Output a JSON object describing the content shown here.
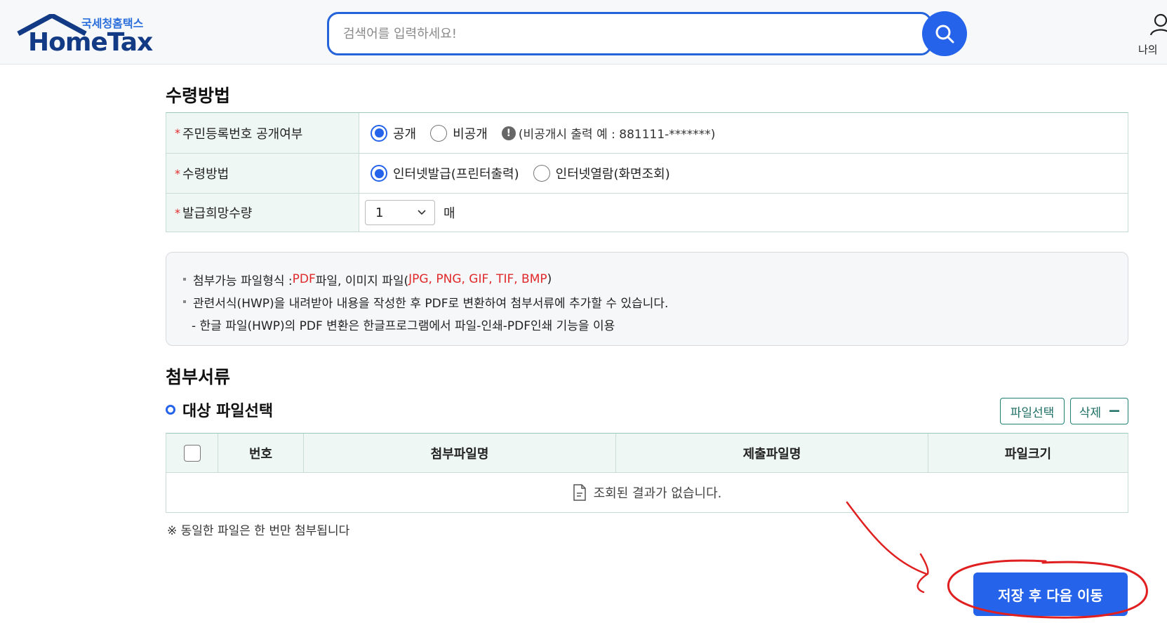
{
  "header": {
    "logo_sub": "국세청홈택스",
    "logo_name": "HomeTax",
    "search_placeholder": "검색어를 입력하세요!",
    "my_menu_label": "나의"
  },
  "receive_section": {
    "title": "수령방법",
    "rows": [
      {
        "label": "주민등록번호 공개여부",
        "options": [
          {
            "label": "공개",
            "selected": true
          },
          {
            "label": "비공개",
            "selected": false
          }
        ],
        "hint": "(비공개시 출력 예 : 881111-*******)"
      },
      {
        "label": "수령방법",
        "options": [
          {
            "label": "인터넷발급(프린터출력)",
            "selected": true
          },
          {
            "label": "인터넷열람(화면조회)",
            "selected": false
          }
        ]
      },
      {
        "label": "발급희망수량",
        "select_value": "1",
        "unit": "매"
      }
    ],
    "required_mark": "*"
  },
  "notice": {
    "line1_prefix": "첨부가능 파일형식 : ",
    "line1_pdf": "PDF",
    "line1_mid": " 파일, 이미지 파일(",
    "line1_types": "JPG, PNG, GIF, TIF, BMP",
    "line1_suffix": ")",
    "line2": "관련서식(HWP)을 내려받아 내용을 작성한 후 PDF로 변환하여 첨부서류에 추가할 수 있습니다.",
    "line3": "- 한글 파일(HWP)의 PDF 변환은 한글프로그램에서 파일-인쇄-PDF인쇄 기능을 이용"
  },
  "attach_section": {
    "title": "첨부서류",
    "subtitle": "대상 파일선택",
    "select_button": "파일선택",
    "delete_button": "삭제",
    "columns": [
      "번호",
      "첨부파일명",
      "제출파일명",
      "파일크기"
    ],
    "empty_message": "조회된 결과가 없습니다.",
    "footnote": "※ 동일한 파일은 한 번만 첨부됩니다"
  },
  "actions": {
    "save_next": "저장 후 다음 이동"
  },
  "colors": {
    "primary": "#2563eb",
    "header_bg": "#f7f8fa",
    "table_header_bg": "#eef7f4",
    "required": "#e0292b",
    "annotation": "#e02020"
  }
}
